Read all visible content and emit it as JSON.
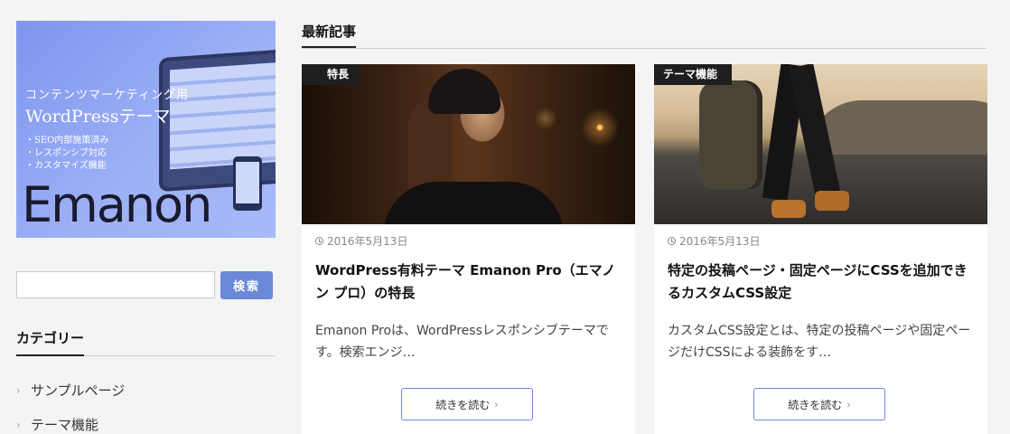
{
  "sidebar": {
    "banner": {
      "line1": "コンテンツマーケティング用",
      "line2": "WordPressテーマ",
      "bullets": [
        "・SEO内部施策済み",
        "・レスポンシブ対応",
        "・カスタマイズ機能"
      ],
      "logo": "Emanon"
    },
    "search": {
      "placeholder": "",
      "button_label": "検索"
    },
    "categories": {
      "heading": "カテゴリー",
      "items": [
        {
          "label": "サンプルページ"
        },
        {
          "label": "テーマ機能"
        }
      ]
    }
  },
  "main": {
    "heading": "最新記事",
    "posts": [
      {
        "tag": "特長",
        "date": "2016年5月13日",
        "title": "WordPress有料テーマ Emanon Pro（エマノン プロ）の特長",
        "excerpt": "Emanon Proは、WordPressレスポンシブテーマです。検索エンジ…",
        "more_label": "続きを読む"
      },
      {
        "tag": "テーマ機能",
        "date": "2016年5月13日",
        "title": "特定の投稿ページ・固定ページにCSSを追加できるカスタムCSS設定",
        "excerpt": "カスタムCSS設定とは、特定の投稿ページや固定ページだけCSSによる装飾をす…",
        "more_label": "続きを読む"
      }
    ]
  },
  "colors": {
    "accent": "#6a89d8",
    "tag_bg": "#1e1e1e",
    "page_bg": "#f4f4f4"
  }
}
